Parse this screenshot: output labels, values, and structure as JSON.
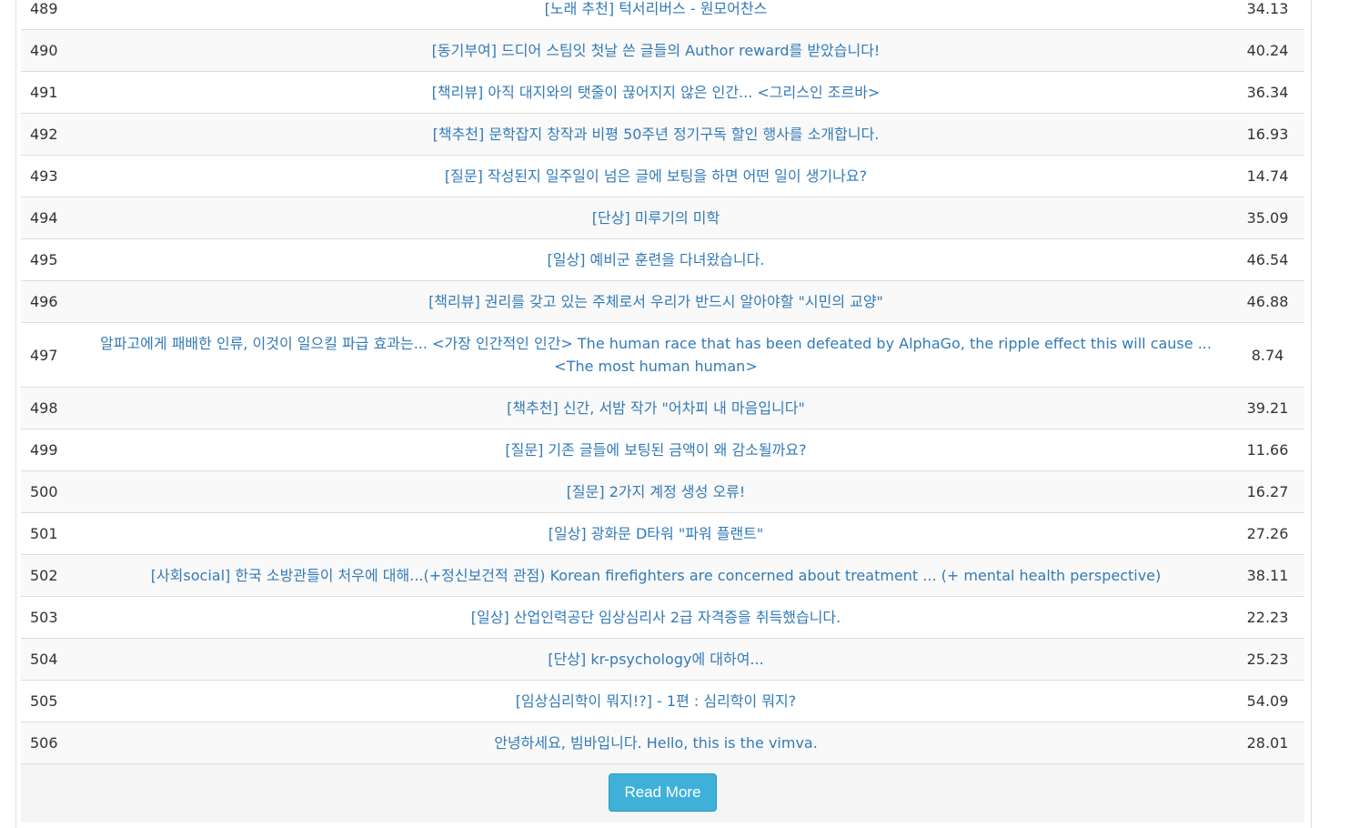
{
  "posts": [
    {
      "num": "489",
      "title": "[노래 추천] 턱서리버스 - 원모어찬스",
      "score": "34.13"
    },
    {
      "num": "490",
      "title": "[동기부여] 드디어 스팀잇 첫날 쓴 글들의 Author reward를 받았습니다!",
      "score": "40.24"
    },
    {
      "num": "491",
      "title": "[책리뷰] 아직 대지와의 탯줄이 끊어지지 않은 인간... <그리스인 조르바>",
      "score": "36.34"
    },
    {
      "num": "492",
      "title": "[책추천] 문학잡지 창작과 비평 50주년 정기구독 할인 행사를 소개합니다.",
      "score": "16.93"
    },
    {
      "num": "493",
      "title": "[질문] 작성된지 일주일이 넘은 글에 보팅을 하면 어떤 일이 생기나요?",
      "score": "14.74"
    },
    {
      "num": "494",
      "title": "[단상] 미루기의 미학",
      "score": "35.09"
    },
    {
      "num": "495",
      "title": "[일상] 예비군 훈련을 다녀왔습니다.",
      "score": "46.54"
    },
    {
      "num": "496",
      "title": "[책리뷰] 권리를 갖고 있는 주체로서 우리가 반드시 알아야할 \"시민의 교양\"",
      "score": "46.88"
    },
    {
      "num": "497",
      "title": "알파고에게 패배한 인류, 이것이 일으킬 파급 효과는... <가장 인간적인 인간> The human race that has been defeated by AlphaGo, the ripple effect this will cause ... <The most human human>",
      "score": "8.74"
    },
    {
      "num": "498",
      "title": "[책추천] 신간, 서밤 작가 \"어차피 내 마음입니다\"",
      "score": "39.21"
    },
    {
      "num": "499",
      "title": "[질문] 기존 글들에 보팅된 금액이 왜 감소될까요?",
      "score": "11.66"
    },
    {
      "num": "500",
      "title": "[질문] 2가지 계정 생성 오류!",
      "score": "16.27"
    },
    {
      "num": "501",
      "title": "[일상] 광화문 D타워 \"파워 플랜트\"",
      "score": "27.26"
    },
    {
      "num": "502",
      "title": "[사회social] 한국 소방관들이 처우에 대해...(+정신보건적 관점) Korean firefighters are concerned about treatment ... (+ mental health perspective)",
      "score": "38.11"
    },
    {
      "num": "503",
      "title": "[일상] 산업인력공단 임상심리사 2급 자격증을 취득했습니다.",
      "score": "22.23"
    },
    {
      "num": "504",
      "title": "[단상] kr-psychology에 대하여...",
      "score": "25.23"
    },
    {
      "num": "505",
      "title": "[임상심리학이 뭐지!?] - 1편 : 심리학이 뭐지?",
      "score": "54.09"
    },
    {
      "num": "506",
      "title": "안녕하세요, 빔바입니다. Hello, this is the vimva.",
      "score": "28.01"
    }
  ],
  "footer": {
    "read_more_label": "Read More"
  },
  "colors": {
    "link": "#337ab7",
    "button": "#3fb1d9"
  }
}
